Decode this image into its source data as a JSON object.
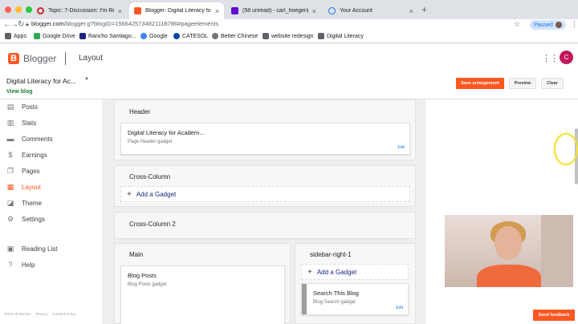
{
  "browser": {
    "tabs": [
      {
        "title": "Topic: 7-Discussion: I'm Ready",
        "icon": "discussion-favicon",
        "color": "#c62828"
      },
      {
        "title": "Blogger: Digital Literacy for Ac",
        "icon": "blogger-favicon",
        "color": "#ff5722"
      },
      {
        "title": "(58 unread) - carl_hoeger@ya",
        "icon": "yahoo-mail-favicon",
        "color": "#6001d2"
      },
      {
        "title": "Your Account",
        "icon": "globe-favicon",
        "color": "#1a73e8"
      }
    ],
    "url_host": "blogger.com",
    "url_path": "/blogger.g?blogID=1566425734821118786#pageelements",
    "profile_status": "Paused"
  },
  "bookmarks": [
    {
      "label": "Apps",
      "color": "#5f6368"
    },
    {
      "label": "Google Drive",
      "color": "#34a853"
    },
    {
      "label": "Rancho Santiago...",
      "color": "#1a237e"
    },
    {
      "label": "Google",
      "color": "#4285f4"
    },
    {
      "label": "CATESOL",
      "color": "#0d47a1"
    },
    {
      "label": "Better Chinese",
      "color": "#757575"
    },
    {
      "label": "website redesign",
      "color": "#5f6368"
    },
    {
      "label": "Digital Literacy",
      "color": "#5f6368"
    }
  ],
  "header": {
    "app_name": "Blogger",
    "page_name": "Layout",
    "user_initial": "C",
    "accent": "#ff5722"
  },
  "blog": {
    "title": "Digital Literacy for Ac...",
    "view_link": "View blog"
  },
  "actions": {
    "save": "Save arrangement",
    "preview": "Preview",
    "clear": "Clear"
  },
  "sidebar": {
    "items": [
      {
        "label": "Posts",
        "icon": "posts-icon"
      },
      {
        "label": "Stats",
        "icon": "stats-icon"
      },
      {
        "label": "Comments",
        "icon": "comments-icon"
      },
      {
        "label": "Earnings",
        "icon": "earnings-icon"
      },
      {
        "label": "Pages",
        "icon": "pages-icon"
      },
      {
        "label": "Layout",
        "icon": "layout-icon",
        "active": true
      },
      {
        "label": "Theme",
        "icon": "theme-icon"
      },
      {
        "label": "Settings",
        "icon": "settings-icon"
      },
      {
        "label": "Reading List",
        "icon": "reading-list-icon"
      },
      {
        "label": "Help",
        "icon": "help-icon"
      }
    ],
    "footer_links": [
      "Terms of Service",
      "Privacy",
      "Content Policy"
    ]
  },
  "layout": {
    "header_section": "Header",
    "header_gadget_title": "Digital Literacy for Academ...",
    "header_gadget_sub": "Page Header gadget",
    "cross_column": "Cross-Column",
    "cross_column_2": "Cross-Column 2",
    "main": "Main",
    "sidebar_right": "sidebar-right-1",
    "add_gadget": "Add a Gadget",
    "blog_posts_title": "Blog Posts",
    "blog_posts_sub": "Blog Posts gadget",
    "search_title": "Search This Blog",
    "search_sub": "Blog Search gadget",
    "edit": "Edit"
  },
  "feedback": "Send feedback"
}
